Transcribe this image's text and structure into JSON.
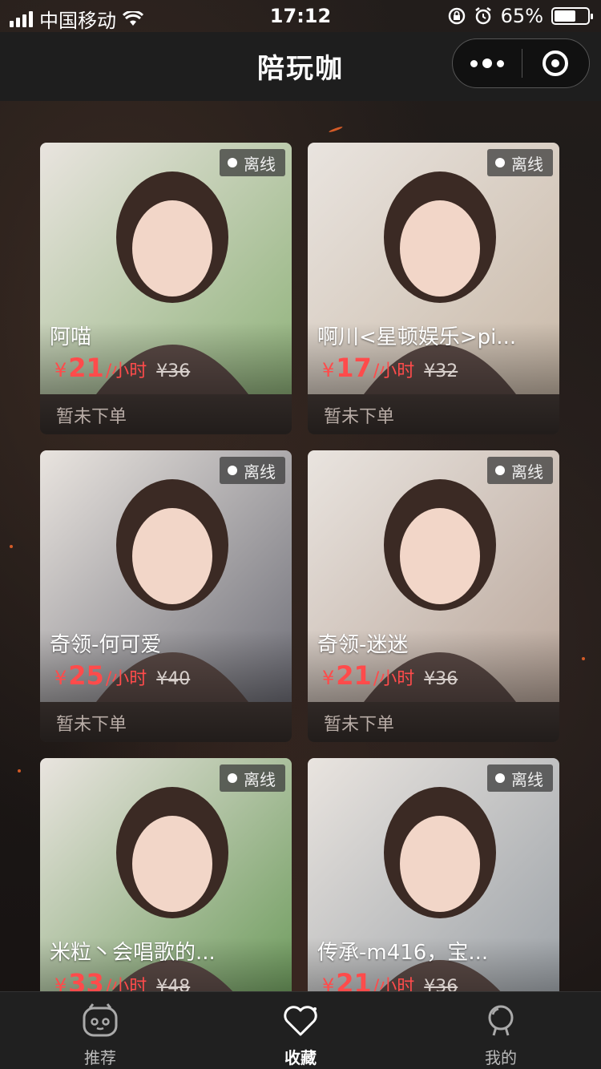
{
  "status_bar": {
    "carrier": "中国移动",
    "time": "17:12",
    "battery": "65%",
    "battery_level": 0.65
  },
  "nav": {
    "title": "陪玩咖"
  },
  "icons": {
    "signal": "signal-icon",
    "wifi": "wifi-icon",
    "rotation_lock": "rotation-lock-icon",
    "alarm": "alarm-icon",
    "more": "more-dots-icon",
    "close": "target-close-icon",
    "recommend": "face-icon",
    "favorites": "heart-icon",
    "mine": "person-icon"
  },
  "colors": {
    "price_red": "#ff4b4b",
    "card_bg": "#4a3f3b",
    "tab_active": "#ffffff"
  },
  "cards": [
    {
      "status": "离线",
      "name": "阿喵",
      "currency": "¥",
      "price": "21",
      "unit": "/小时",
      "original_price": "¥36",
      "order_status": "暂未下单",
      "photo_theme": "#8fb27a"
    },
    {
      "status": "离线",
      "name": "啊川<星顿娱乐>pi...",
      "currency": "¥",
      "price": "17",
      "unit": "/小时",
      "original_price": "¥32",
      "order_status": "暂未下单",
      "photo_theme": "#c9b9a8"
    },
    {
      "status": "离线",
      "name": "奇领-何可爱",
      "currency": "¥",
      "price": "25",
      "unit": "/小时",
      "original_price": "¥40",
      "order_status": "暂未下单",
      "photo_theme": "#6f6f78"
    },
    {
      "status": "离线",
      "name": "奇领-迷迷",
      "currency": "¥",
      "price": "21",
      "unit": "/小时",
      "original_price": "¥36",
      "order_status": "暂未下单",
      "photo_theme": "#b9a69a"
    },
    {
      "status": "离线",
      "name": "米粒丶会唱歌的...",
      "currency": "¥",
      "price": "33",
      "unit": "/小时",
      "original_price": "¥48",
      "order_status": "",
      "photo_theme": "#6b9a5a"
    },
    {
      "status": "离线",
      "name": "传承-m416，宝...",
      "currency": "¥",
      "price": "21",
      "unit": "/小时",
      "original_price": "¥36",
      "order_status": "",
      "photo_theme": "#9aa0a6"
    }
  ],
  "tabbar": {
    "tabs": [
      {
        "label": "推荐",
        "active": false
      },
      {
        "label": "收藏",
        "active": true
      },
      {
        "label": "我的",
        "active": false
      }
    ]
  }
}
